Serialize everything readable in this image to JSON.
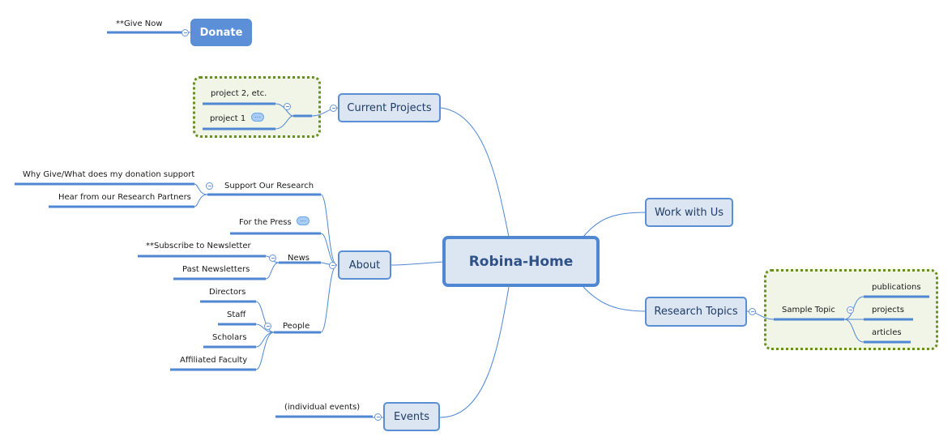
{
  "central": {
    "label": "Robina-Home"
  },
  "donate": {
    "label": "Donate",
    "child": "**Give Now",
    "color": "#5b8fd8"
  },
  "current_projects": {
    "label": "Current Projects",
    "children": [
      "project 2, etc.",
      "project 1"
    ],
    "project1_has_note": true
  },
  "about": {
    "label": "About",
    "support": {
      "label": "Support Our Research",
      "children": [
        "Why Give/What does my donation support",
        "Hear from our Research Partners"
      ]
    },
    "press": {
      "label": "For the Press",
      "has_note": true
    },
    "news": {
      "label": "News",
      "children": [
        "**Subscribe to Newsletter",
        "Past Newsletters"
      ]
    },
    "people": {
      "label": "People",
      "children": [
        "Directors",
        "Staff",
        "Scholars",
        "Affiliated Faculty"
      ]
    }
  },
  "events": {
    "label": "Events",
    "children": [
      "(individual events)"
    ]
  },
  "work_with_us": {
    "label": "Work with Us"
  },
  "research_topics": {
    "label": "Research Topics",
    "sample_topic": {
      "label": "Sample Topic",
      "children": [
        "publications",
        "projects",
        "articles"
      ]
    }
  },
  "colors": {
    "node_fill": "#dce5f2",
    "node_border": "#5a8fd6",
    "boundary_border": "#6b8e23",
    "boundary_fill": "#f1f5e8",
    "line": "#4f87d3"
  },
  "note_glyph": "…",
  "collapse_glyph": "−"
}
